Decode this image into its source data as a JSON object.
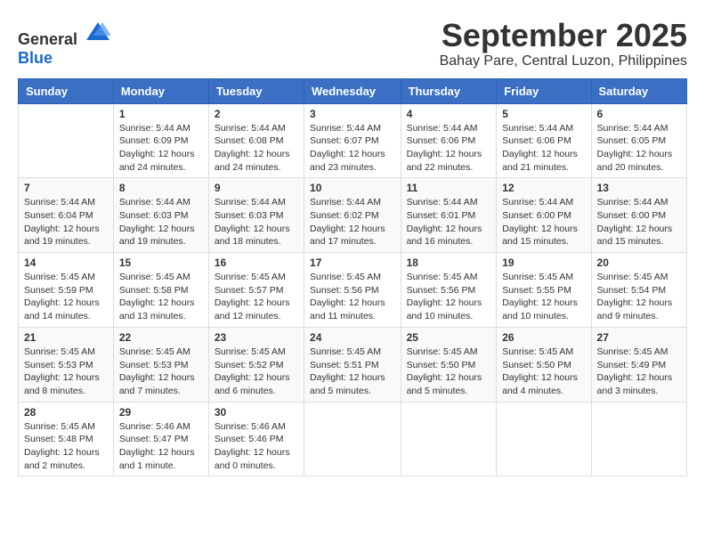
{
  "header": {
    "logo": {
      "general": "General",
      "blue": "Blue"
    },
    "title": "September 2025",
    "location": "Bahay Pare, Central Luzon, Philippines"
  },
  "days_of_week": [
    "Sunday",
    "Monday",
    "Tuesday",
    "Wednesday",
    "Thursday",
    "Friday",
    "Saturday"
  ],
  "weeks": [
    [
      null,
      {
        "day": 1,
        "sunrise": "5:44 AM",
        "sunset": "6:09 PM",
        "daylight": "12 hours and 24 minutes."
      },
      {
        "day": 2,
        "sunrise": "5:44 AM",
        "sunset": "6:08 PM",
        "daylight": "12 hours and 24 minutes."
      },
      {
        "day": 3,
        "sunrise": "5:44 AM",
        "sunset": "6:07 PM",
        "daylight": "12 hours and 23 minutes."
      },
      {
        "day": 4,
        "sunrise": "5:44 AM",
        "sunset": "6:06 PM",
        "daylight": "12 hours and 22 minutes."
      },
      {
        "day": 5,
        "sunrise": "5:44 AM",
        "sunset": "6:06 PM",
        "daylight": "12 hours and 21 minutes."
      },
      {
        "day": 6,
        "sunrise": "5:44 AM",
        "sunset": "6:05 PM",
        "daylight": "12 hours and 20 minutes."
      }
    ],
    [
      {
        "day": 7,
        "sunrise": "5:44 AM",
        "sunset": "6:04 PM",
        "daylight": "12 hours and 19 minutes."
      },
      {
        "day": 8,
        "sunrise": "5:44 AM",
        "sunset": "6:03 PM",
        "daylight": "12 hours and 19 minutes."
      },
      {
        "day": 9,
        "sunrise": "5:44 AM",
        "sunset": "6:03 PM",
        "daylight": "12 hours and 18 minutes."
      },
      {
        "day": 10,
        "sunrise": "5:44 AM",
        "sunset": "6:02 PM",
        "daylight": "12 hours and 17 minutes."
      },
      {
        "day": 11,
        "sunrise": "5:44 AM",
        "sunset": "6:01 PM",
        "daylight": "12 hours and 16 minutes."
      },
      {
        "day": 12,
        "sunrise": "5:44 AM",
        "sunset": "6:00 PM",
        "daylight": "12 hours and 15 minutes."
      },
      {
        "day": 13,
        "sunrise": "5:44 AM",
        "sunset": "6:00 PM",
        "daylight": "12 hours and 15 minutes."
      }
    ],
    [
      {
        "day": 14,
        "sunrise": "5:45 AM",
        "sunset": "5:59 PM",
        "daylight": "12 hours and 14 minutes."
      },
      {
        "day": 15,
        "sunrise": "5:45 AM",
        "sunset": "5:58 PM",
        "daylight": "12 hours and 13 minutes."
      },
      {
        "day": 16,
        "sunrise": "5:45 AM",
        "sunset": "5:57 PM",
        "daylight": "12 hours and 12 minutes."
      },
      {
        "day": 17,
        "sunrise": "5:45 AM",
        "sunset": "5:56 PM",
        "daylight": "12 hours and 11 minutes."
      },
      {
        "day": 18,
        "sunrise": "5:45 AM",
        "sunset": "5:56 PM",
        "daylight": "12 hours and 10 minutes."
      },
      {
        "day": 19,
        "sunrise": "5:45 AM",
        "sunset": "5:55 PM",
        "daylight": "12 hours and 10 minutes."
      },
      {
        "day": 20,
        "sunrise": "5:45 AM",
        "sunset": "5:54 PM",
        "daylight": "12 hours and 9 minutes."
      }
    ],
    [
      {
        "day": 21,
        "sunrise": "5:45 AM",
        "sunset": "5:53 PM",
        "daylight": "12 hours and 8 minutes."
      },
      {
        "day": 22,
        "sunrise": "5:45 AM",
        "sunset": "5:53 PM",
        "daylight": "12 hours and 7 minutes."
      },
      {
        "day": 23,
        "sunrise": "5:45 AM",
        "sunset": "5:52 PM",
        "daylight": "12 hours and 6 minutes."
      },
      {
        "day": 24,
        "sunrise": "5:45 AM",
        "sunset": "5:51 PM",
        "daylight": "12 hours and 5 minutes."
      },
      {
        "day": 25,
        "sunrise": "5:45 AM",
        "sunset": "5:50 PM",
        "daylight": "12 hours and 5 minutes."
      },
      {
        "day": 26,
        "sunrise": "5:45 AM",
        "sunset": "5:50 PM",
        "daylight": "12 hours and 4 minutes."
      },
      {
        "day": 27,
        "sunrise": "5:45 AM",
        "sunset": "5:49 PM",
        "daylight": "12 hours and 3 minutes."
      }
    ],
    [
      {
        "day": 28,
        "sunrise": "5:45 AM",
        "sunset": "5:48 PM",
        "daylight": "12 hours and 2 minutes."
      },
      {
        "day": 29,
        "sunrise": "5:46 AM",
        "sunset": "5:47 PM",
        "daylight": "12 hours and 1 minute."
      },
      {
        "day": 30,
        "sunrise": "5:46 AM",
        "sunset": "5:46 PM",
        "daylight": "12 hours and 0 minutes."
      },
      null,
      null,
      null,
      null
    ]
  ]
}
